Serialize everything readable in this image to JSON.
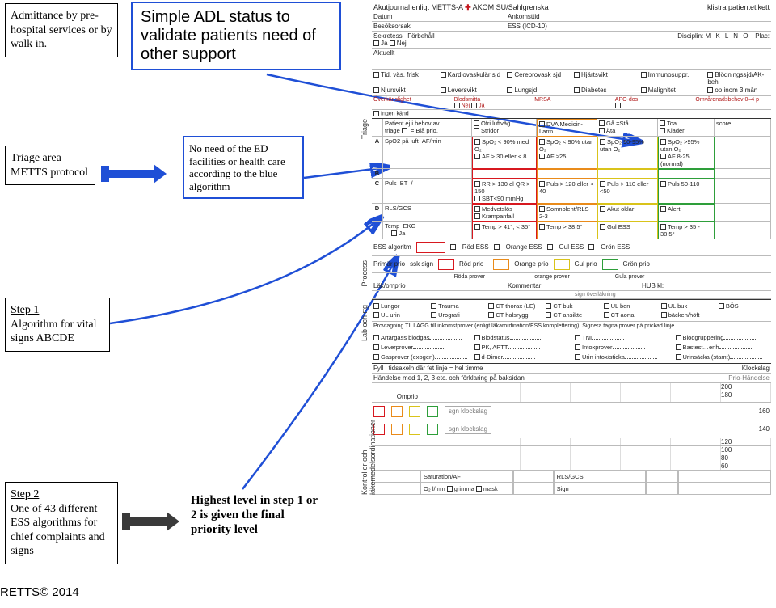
{
  "left": {
    "admittance": "Admittance by pre-hospital services or by walk in.",
    "adl": "Simple ADL status to validate patients need of other support",
    "triage_label": "Triage area METTS protocol",
    "blue_algo": "No need of the ED facilities or health care according to the blue algorithm",
    "step1_title": "Step 1",
    "step1_body": "Algorithm for vital signs ABCDE",
    "step2_title": "Step 2",
    "step2_body": "One of 43 different ESS algorithms for chief complaints and signs",
    "highest": "Highest level in step 1 or 2 is given the final priority level"
  },
  "form": {
    "title_left": "Akutjournal enligt METTS-A",
    "brand": "AKOM SU/Sahlgrenska",
    "title_right": "klistra patientetikett",
    "row_datum": "Datum",
    "row_ankomsttid": "Ankomsttid",
    "row_besok": "Besöksorsak",
    "row_ess": "ESS (ICD-10)",
    "sekretess": "Sekretess",
    "forbehall": "Förbehåll",
    "ja": "Ja",
    "nej": "Nej",
    "disciplin": "Disciplin:",
    "mklno": "M  K  L  N  O",
    "plac": "Plac:",
    "aktuellt": "Aktuellt",
    "history_items": [
      "Tid. väs. frisk",
      "Kardiovaskulär sjd",
      "Cerebrovask sjd",
      "Hjärtsvikt",
      "Immunosuppr.",
      "Blödningssjd/AK-beh",
      "Njursvikt",
      "Leversvikt",
      "Lungsjd",
      "Diabetes",
      "Malignitet",
      "op inom 3 mån"
    ],
    "overkanslighet": "Överkänslighet",
    "blodsmitta": "Blodsmitta",
    "mrsa": "MRSA",
    "apo": "APO-dos",
    "omvard": "Omvårdnadsbehov 0–4 p",
    "ingen_kand": "Ingen känd",
    "triage": {
      "vlabel": "Triage",
      "patient_ej": "Patient ej i behov av",
      "triage": "triage",
      "bla_prio": "= Blå prio.",
      "spo2": "SpO2 på luft",
      "af": "AF/min",
      "puls": "Puls",
      "bt": "BT",
      "rls": "RLS/GCS",
      "temp": "Temp",
      "ekg": "EKG",
      "slash": "/",
      "red": {
        "spo2": "SpO₂ < 90% med O₂",
        "af": "AF > 30 eller < 8",
        "puls": "RR > 130 el QR > 150",
        "sbt": "SBT<90 mmHg",
        "rls": "Medvetslös",
        "kramp": "Krampanfall",
        "temp": "Temp > 41°, < 35°"
      },
      "orange": {
        "spo2": "SpO₂ < 90% utan O₂",
        "af": "AF >25",
        "puls": "Puls > 120 eller < 40",
        "rls": "Somnolent/RLS 2-3",
        "temp": "Temp > 38,5°"
      },
      "yellow": {
        "spo2": "SpO₂ 90-95% utan O₂",
        "puls": "Puls > 110 eller <50",
        "rls": "Akut oklar",
        "temp": "Gul ESS"
      },
      "green": {
        "spo2": "SpO₂ >95% utan O₂",
        "af": "AF 8-25 (normal)",
        "puls": "Puls 50-110",
        "rls": "Alert",
        "temp": "Temp > 35 - 38,5°"
      },
      "adl": {
        "dva": "DVA",
        "medicin": "Medicin-Larm",
        "ga": "Gå =Stå",
        "ata": "Äta",
        "toa": "Toa",
        "klader": "Kläder",
        "score": "score"
      },
      "a_label": "Ofri luftväg",
      "b_label": "Stridor"
    },
    "ess_row": {
      "label": "ESS algoritm",
      "red": "Röd ESS",
      "orange": "Orange ESS",
      "yellow": "Gul ESS",
      "green": "Grön ESS"
    },
    "process": {
      "vlabel": "Process",
      "primar": "Primär prio",
      "ssk": "ssk sign",
      "red": "Röd prio",
      "red2": "Röda prover",
      "orange": "Orange prio",
      "orange2": "orange prover",
      "yellow": "Gul prio",
      "yellow2": "Gula prover",
      "green": "Grön prio",
      "lak": "Läk/omprio",
      "kommentar": "Kommentar:",
      "hub": "HUB kl:",
      "sign": "sign överläkning"
    },
    "lab": {
      "vlabel": "Lab och rtg",
      "items": [
        "Lungor",
        "Trauma",
        "CT thorax (LE)",
        "CT buk",
        "UL ben",
        "UL buk",
        "BÖS",
        "UL urin",
        "Urografi",
        "CT halsrygg",
        "CT ansikte",
        "CT aorta",
        "bäcken/höft"
      ],
      "provtag": "Provtagning TILLÄGG till inkomstprover (enligt läkarordination/ESS komplettering). Signera tagna prover på prickad linje.",
      "blood": [
        "Artärgass blodgas",
        "Blodstatus",
        "TNI",
        "Blodgruppering",
        "Leverprover",
        "PK, APTT",
        "Intoxprover",
        "Bastest…enh",
        "Gasprover (exogen)",
        "d-Dimer",
        "Urin intox/sticka",
        "Urinsäcka (stamt)"
      ]
    },
    "timeline": {
      "vlabel": "Kontroller och läkemedelsordinationer",
      "fill": "Fyll i tidsaxeln där fet linje = hel timme",
      "handelse": "Händelse med 1, 2, 3 etc. och förklaring på baksidan",
      "klockslag": "Klockslag",
      "prioh": "Prio-Händelse",
      "omprio": "Omprio",
      "sgn1": "sgn klockslag",
      "sgn2": "sgn klockslag",
      "rows": [
        "200",
        "180",
        "160",
        "140",
        "120",
        "100",
        "80",
        "60"
      ],
      "sat": "Saturation/AF",
      "rlsg": "RLS/GCS",
      "o2": "O₂ l/min",
      "grimma": "grimma",
      "mask": "mask",
      "sign": "Sign"
    }
  },
  "footer": "RETTS© 2014"
}
